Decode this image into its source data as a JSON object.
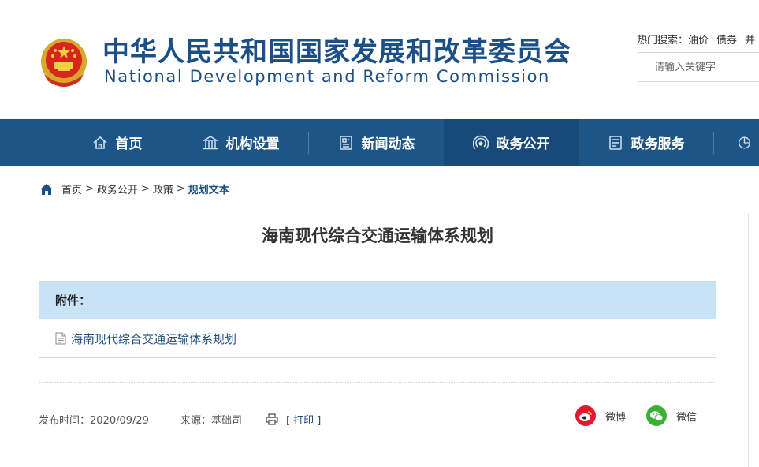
{
  "header": {
    "title_cn": "中华人民共和国国家发展和改革委员会",
    "title_en": "National Development and Reform Commission",
    "hot_search_label": "热门搜索：",
    "hot_search_items": [
      "油价",
      "债券",
      "并"
    ],
    "search_placeholder": "请输入关键字"
  },
  "nav": {
    "items": [
      {
        "label": "首页",
        "icon": "home-icon"
      },
      {
        "label": "机构设置",
        "icon": "building-icon"
      },
      {
        "label": "新闻动态",
        "icon": "news-icon"
      },
      {
        "label": "政务公开",
        "icon": "broadcast-icon"
      },
      {
        "label": "政务服务",
        "icon": "document-icon"
      },
      {
        "label": "",
        "icon": "pie-chart-icon"
      }
    ],
    "active_index": 3
  },
  "breadcrumb": {
    "items": [
      "首页",
      "政务公开",
      "政策"
    ],
    "separator": ">",
    "current": "规划文本"
  },
  "article": {
    "title": "海南现代综合交通运输体系规划",
    "attachment_header": "附件：",
    "attachment_name": "海南现代综合交通运输体系规划",
    "publish_time": "发布时间：2020/09/29",
    "source": "来源：基础司",
    "print_label": "[ 打印 ]"
  },
  "share": {
    "weibo_label": "微博",
    "wechat_label": "微信"
  },
  "colors": {
    "brand_blue": "#1c4f86",
    "nav_bg": "#1d5587",
    "nav_active": "#174a78",
    "attach_head_bg": "#c8e3f5",
    "weibo_red": "#e6162d",
    "wechat_green": "#3cb034"
  }
}
